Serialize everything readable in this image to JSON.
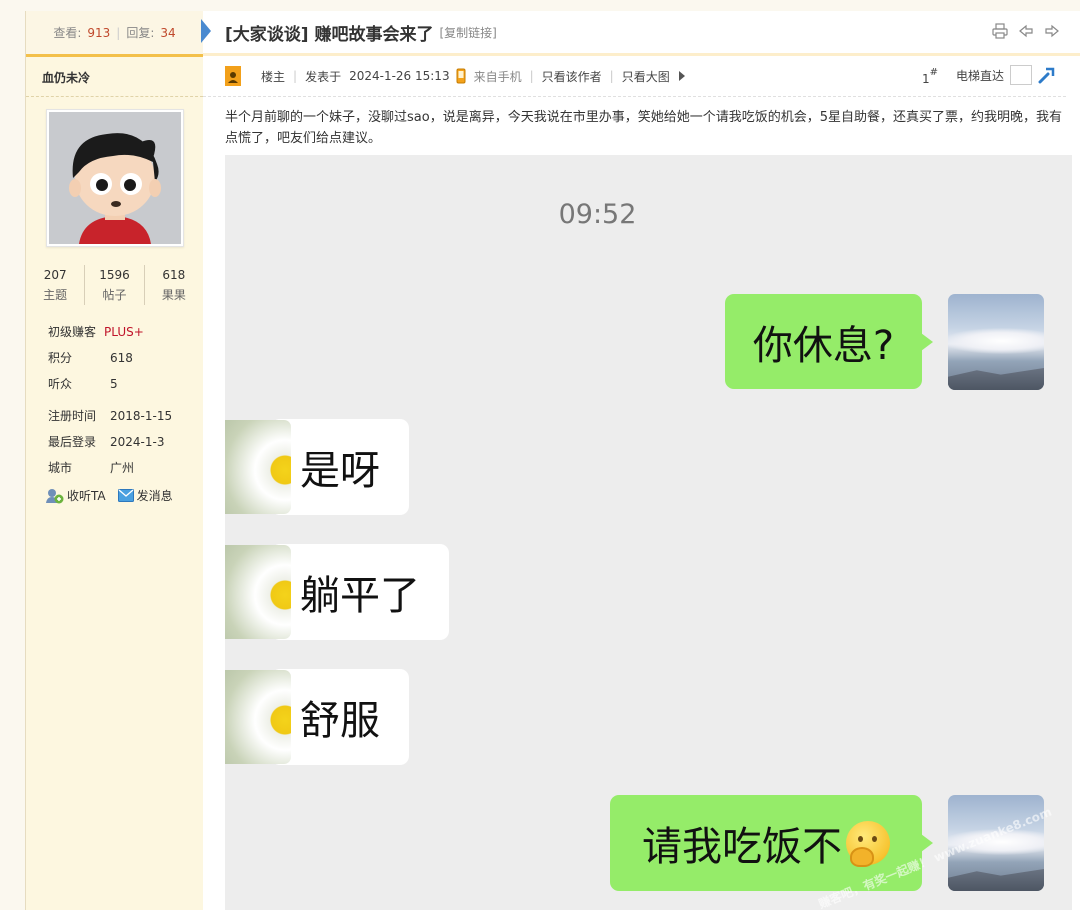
{
  "sidebar": {
    "views_label": "查看:",
    "views": "913",
    "replies_label": "回复:",
    "replies": "34",
    "username": "血仍未冷",
    "counts": [
      {
        "value": "207",
        "label": "主题"
      },
      {
        "value": "1596",
        "label": "帖子"
      },
      {
        "value": "618",
        "label": "果果"
      }
    ],
    "rank": "初级赚客",
    "rank_badge": "PLUS+",
    "points_label": "积分",
    "points": "618",
    "listeners_label": "听众",
    "listeners": "5",
    "reg_label": "注册时间",
    "reg_date": "2018-1-15",
    "last_label": "最后登录",
    "last_login": "2024-1-3",
    "city_label": "城市",
    "city": "广州",
    "follow_label": "收听TA",
    "message_label": "发消息"
  },
  "thread": {
    "title": "[大家谈谈] 赚吧故事会来了",
    "copy_link": "[复制链接]"
  },
  "post_meta": {
    "owner_label": "楼主",
    "posted_label": "发表于",
    "posted_time": "2024-1-26 15:13",
    "source": "来自手机",
    "only_author": "只看该作者",
    "only_images": "只看大图",
    "floor_num": "1",
    "floor_sign": "#",
    "elevator": "电梯直达"
  },
  "post_text": "半个月前聊的一个妹子，没聊过sao，说是离异，今天我说在市里办事，笑她给她一个请我吃饭的机会，5星自助餐，还真买了票，约我明晚，我有点慌了，吧友们给点建议。",
  "chat": {
    "time": "09:52",
    "messages": [
      {
        "side": "me",
        "text": "你休息?"
      },
      {
        "side": "other",
        "text": "是呀"
      },
      {
        "side": "other",
        "text": "躺平了"
      },
      {
        "side": "other",
        "text": "舒服"
      },
      {
        "side": "me",
        "text": "请我吃饭不"
      }
    ],
    "emoji": "thinking-face-icon",
    "watermark": "赚客吧，有奖一起赚！ www.zuanke8.com"
  },
  "colors": {
    "accent": "#4a8ad0",
    "me_bubble": "#95ec69",
    "stat_num": "#c0492c",
    "plus_badge": "#c0142a"
  }
}
